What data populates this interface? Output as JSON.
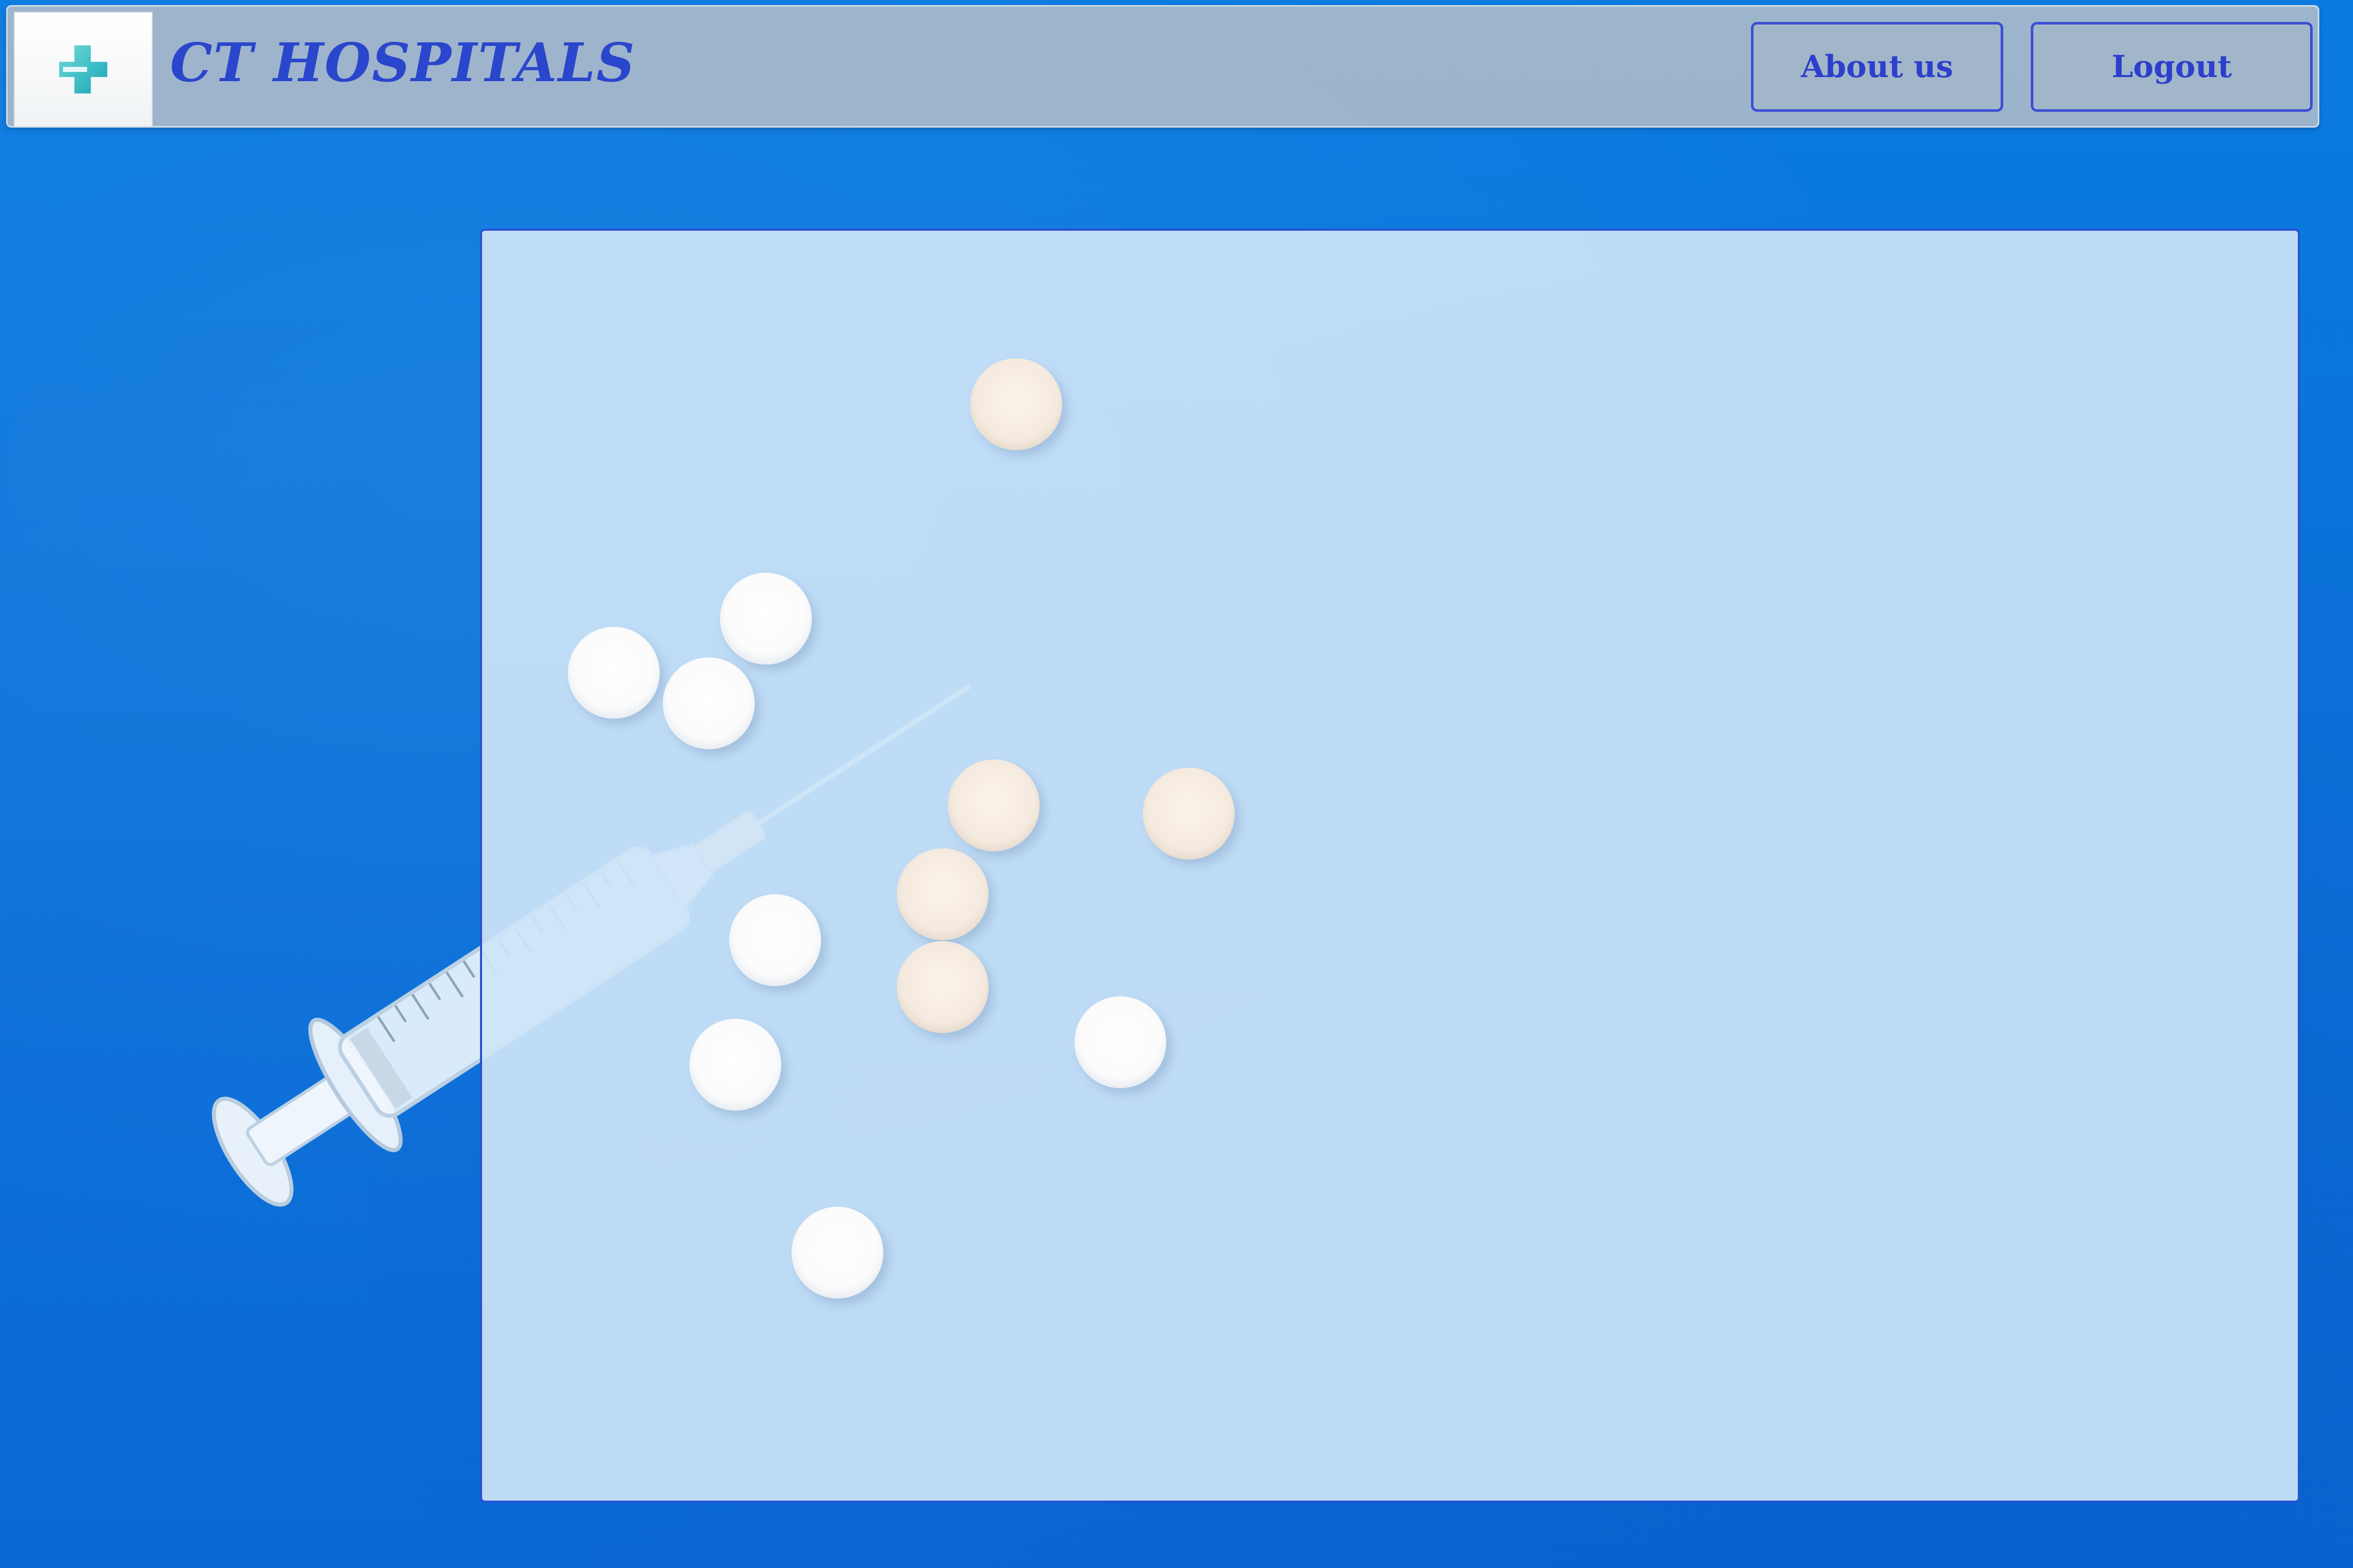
{
  "header": {
    "brand_title": "CT HOSPITALS",
    "logo_icon": "medical-cross-icon",
    "about_label": "About us",
    "logout_label": "Logout"
  },
  "colors": {
    "page_background": "#0a74dc",
    "header_background": "#b0bcc8",
    "brand_text": "#2a46cc",
    "button_border": "#3b4fd3",
    "panel_background": "#cee5f8",
    "panel_border": "#2a4fd6",
    "logo_cross": "#2fc0c9"
  },
  "main": {
    "background_image": "syringe-and-pills-photo"
  }
}
